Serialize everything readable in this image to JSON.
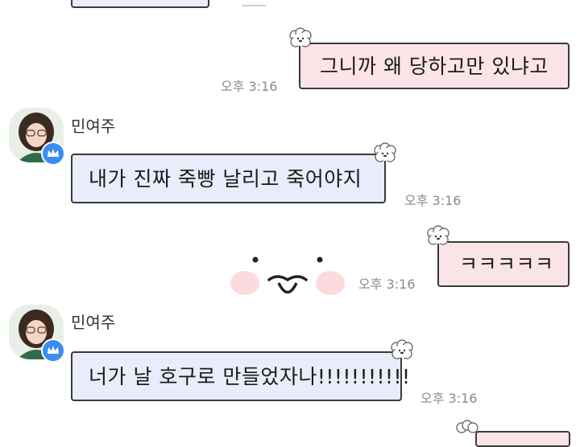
{
  "colors": {
    "outgoing_bubble": "#fbe4e8",
    "incoming_bubble": "#e9ecfa",
    "bubble_border": "#3a3a3a",
    "timestamp": "#8a8a8a",
    "badge": "#3b8ef0"
  },
  "messages": [
    {
      "direction": "outgoing",
      "text": "그니까 왜 당하고만 있냐고",
      "time": "오후 3:16"
    },
    {
      "direction": "incoming",
      "sender": "민여주",
      "text": "내가 진짜 죽빵 날리고 죽어야지",
      "time": "오후 3:16"
    },
    {
      "direction": "outgoing",
      "text": "ㅋㅋㅋㅋㅋ",
      "time": "오후 3:16",
      "emoticon": "white-bunny-face-sticker"
    },
    {
      "direction": "incoming",
      "sender": "민여주",
      "text": "너가 날 호구로 만들었자나!!!!!!!!!!!",
      "time": "오후 3:16"
    }
  ],
  "icons": {
    "bubble_decoration": "sheep-icon",
    "avatar_badge": "crown-icon"
  }
}
